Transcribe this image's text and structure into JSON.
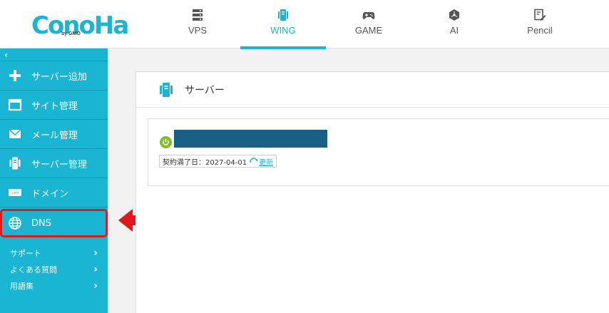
{
  "header": {
    "logo_text": "ConoHa",
    "logo_sub": "by GMO",
    "nav": [
      {
        "label": "VPS",
        "icon": "server-rack-icon"
      },
      {
        "label": "WING",
        "icon": "wing-server-icon"
      },
      {
        "label": "GAME",
        "icon": "gamepad-icon"
      },
      {
        "label": "AI",
        "icon": "ai-network-icon"
      },
      {
        "label": "Pencil",
        "icon": "pencil-document-icon"
      }
    ],
    "active_nav": "WING"
  },
  "sidebar": {
    "collapse_label": "‹",
    "items": [
      {
        "label": "サーバー追加",
        "icon": "plus-icon"
      },
      {
        "label": "サイト管理",
        "icon": "browser-window-icon"
      },
      {
        "label": "メール管理",
        "icon": "envelope-icon"
      },
      {
        "label": "サーバー管理",
        "icon": "server-icon"
      },
      {
        "label": "ドメイン",
        "icon": "domain-card-icon",
        "icon_text": ".com"
      },
      {
        "label": "DNS",
        "icon": "globe-icon"
      }
    ],
    "links": [
      {
        "label": "サポート",
        "chevron": "›"
      },
      {
        "label": "よくある質問",
        "chevron": "›"
      },
      {
        "label": "用語集",
        "chevron": "›"
      }
    ]
  },
  "main": {
    "title": "サーバー",
    "server": {
      "expiry_label": "契約満了日：2027-04-01",
      "renew_label": "更新"
    }
  },
  "colors": {
    "accent": "#19b5d3",
    "highlight": "#e3181d",
    "power_on": "#7fbf2a",
    "name_bar": "#1a5f85"
  }
}
